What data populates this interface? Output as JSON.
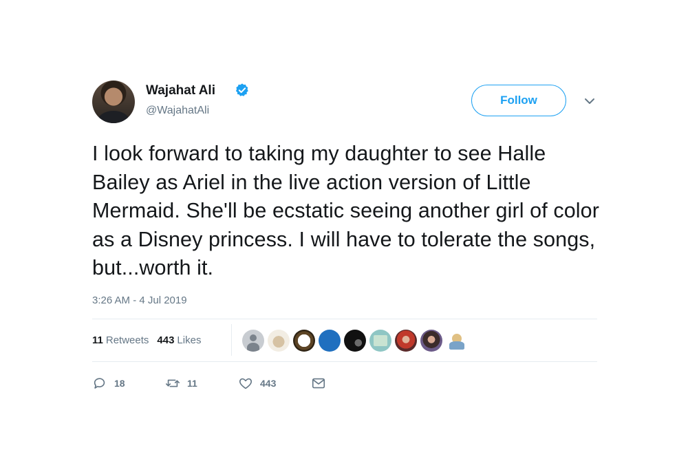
{
  "author": {
    "display_name": "Wajahat Ali",
    "handle": "@WajahatAli",
    "verified": true
  },
  "follow_button": {
    "label": "Follow"
  },
  "menu": {
    "icon": "chevron-down-icon"
  },
  "tweet": {
    "text": "I look forward to taking my daughter to see Halle Bailey as Ariel in the live action version of Little Mermaid. She'll be ecstatic seeing another girl of color as a Disney princess. I will have to tolerate the songs, but...worth it.",
    "timestamp": "3:26 AM - 4 Jul 2019"
  },
  "stats": {
    "retweets_count": "11",
    "retweets_label": "Retweets",
    "likes_count": "443",
    "likes_label": "Likes"
  },
  "likers": [
    "default-avatar",
    "dog-avatar",
    "wreath-logo-avatar",
    "blue-avatar",
    "dark-avatar",
    "sign-avatar",
    "redhead-avatar",
    "woman-avatar",
    "mascot-avatar"
  ],
  "actions": {
    "reply_count": "18",
    "retweet_count": "11",
    "like_count": "443"
  },
  "colors": {
    "accent": "#1da1f2",
    "text": "#14171a",
    "secondary_text": "#657786",
    "divider": "#e6ecf0"
  }
}
